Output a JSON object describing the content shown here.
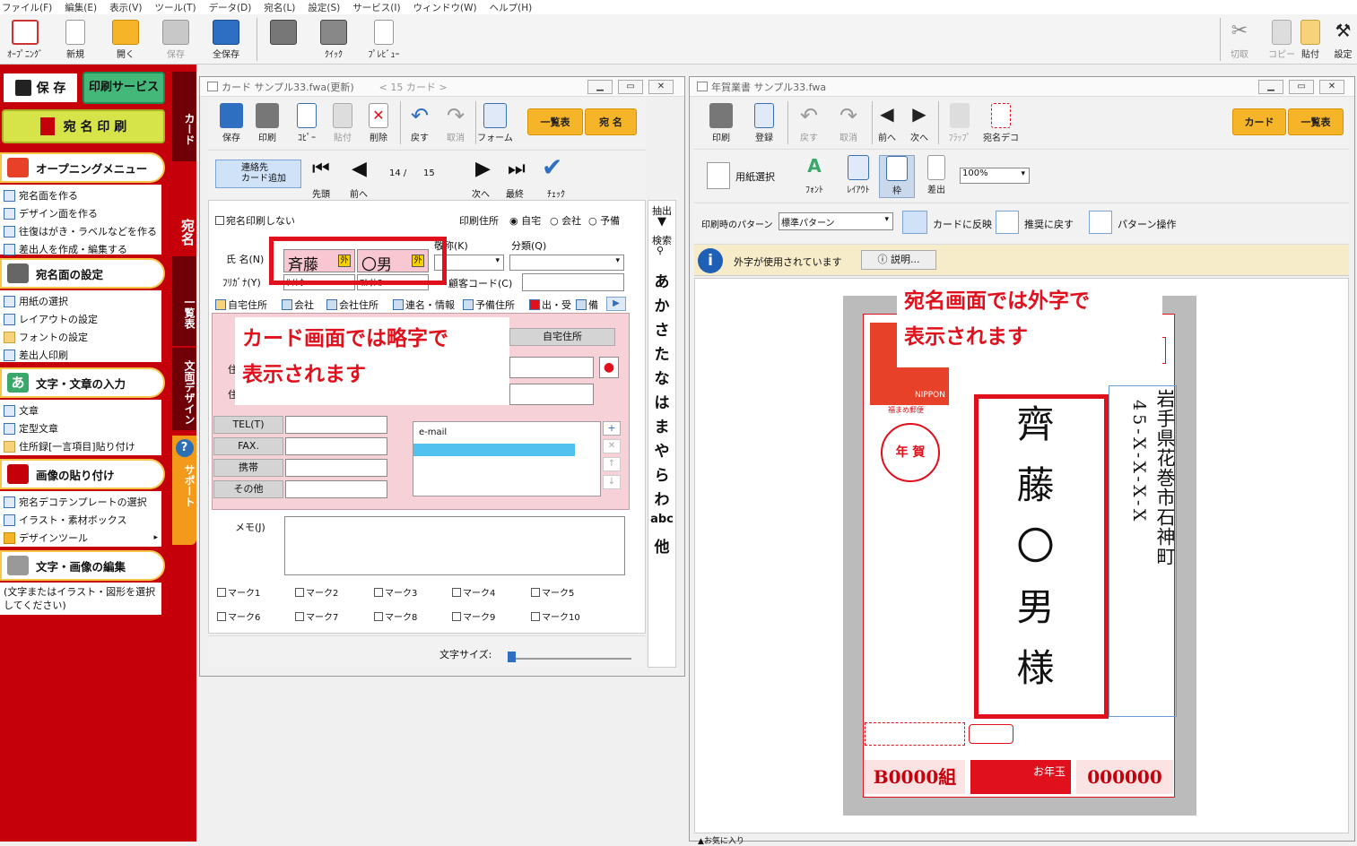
{
  "menu": [
    "ファイル(F)",
    "編集(E)",
    "表示(V)",
    "ツール(T)",
    "データ(D)",
    "宛名(L)",
    "設定(S)",
    "サービス(I)",
    "ウィンドウ(W)",
    "ヘルプ(H)"
  ],
  "toolbar": {
    "opening": "ｵｰﾌﾟﾆﾝｸﾞ",
    "new": "新規",
    "open": "開く",
    "save": "保存",
    "save_all": "全保存",
    "quick": "ｸｲｯｸ",
    "preview": "ﾌﾟﾚﾋﾞｭｰ",
    "cut": "切取",
    "copy": "コピー",
    "paste": "貼付",
    "settings": "設定"
  },
  "left": {
    "save_btn": "保 存",
    "print_service": "印刷サービス",
    "address_print": "宛 名 印 刷",
    "sections": [
      {
        "title": "オープニングメニュー",
        "items": [
          "宛名面を作る",
          "デザイン面を作る",
          "往復はがき・ラベルなどを作る",
          "差出人を作成・編集する"
        ]
      },
      {
        "title": "宛名面の設定",
        "items": [
          "用紙の選択",
          "レイアウトの設定",
          "フォントの設定",
          "差出人印刷"
        ]
      },
      {
        "title": "文字・文章の入力",
        "items": [
          "文章",
          "定型文章",
          "住所録[一言項目]貼り付け"
        ]
      },
      {
        "title": "画像の貼り付け",
        "items": [
          "宛名デコテンプレートの選択",
          "イラスト・素材ボックス",
          "デザインツール"
        ]
      },
      {
        "title": "文字・画像の編集",
        "items": []
      }
    ],
    "edit_hint": "(文字またはイラスト・図形を選択してください)"
  },
  "vtabs": [
    "カード",
    "宛名",
    "一覧表",
    "文面デザイン",
    "サポート"
  ],
  "card": {
    "title": "カード サンプル33.fwa(更新)",
    "count": "< 15 カード >",
    "tb": [
      "保存",
      "印刷",
      "ｺﾋﾟｰ",
      "貼付",
      "削除",
      "戻す",
      "取消",
      "フォーム"
    ],
    "list_btn": "一覧表",
    "address_btn": "宛 名",
    "add_contact": "連絡先\nカード追加",
    "nav": {
      "first": "先頭",
      "prev": "前へ",
      "current": "14 /",
      "total": "15",
      "next": "次へ",
      "last": "最終",
      "check": "ﾁｪｯｸ"
    },
    "no_print": "宛名印刷しない",
    "print_addr_label": "印刷住所",
    "print_addr_opts": [
      "自宅",
      "会社",
      "予備"
    ],
    "name_label": "氏 名(N)",
    "surname": "斉藤",
    "given": "〇男",
    "gaiji": "外",
    "honorific_label": "敬称(K)",
    "category_label": "分類(Q)",
    "furigana_label": "ﾌﾘｶﾞﾅ(Y)",
    "furigana_sei": "ｻｲﾄｳ",
    "furigana_mei": "ﾏﾙｵﾄｺ",
    "customer_code": "顧客コード(C)",
    "tabs": [
      "自宅住所",
      "会社",
      "会社住所",
      "連名・情報",
      "予備住所",
      "出・受",
      "備"
    ],
    "home_addr_hdr": "自宅住所",
    "addr_label": "住",
    "tel": "TEL(T)",
    "fax": "FAX.",
    "mobile": "携帯",
    "other": "その他",
    "email_label": "e-mail",
    "memo_label": "メモ(J)",
    "marks": [
      "マーク1",
      "マーク2",
      "マーク3",
      "マーク4",
      "マーク5",
      "マーク6",
      "マーク7",
      "マーク8",
      "マーク9",
      "マーク10"
    ],
    "font_size_label": "文字サイズ:",
    "extract": "抽出",
    "search": "検索",
    "kana": [
      "あ",
      "か",
      "さ",
      "た",
      "な",
      "は",
      "ま",
      "や",
      "ら",
      "わ",
      "abc",
      "他"
    ],
    "note": "カード画面では略字で\n表示されます"
  },
  "nenga": {
    "title": "年賀業書 サンプル33.fwa",
    "tb": [
      "印刷",
      "登録",
      "戻す",
      "取消",
      "前へ",
      "次へ",
      "ﾌﾗｯﾌﾟ",
      "宛名デコ"
    ],
    "card_btn": "カード",
    "list_btn": "一覧表",
    "tb2": [
      "用紙選択",
      "ﾌｫﾝﾄ",
      "ﾚｲｱｳﾄ",
      "枠",
      "差出"
    ],
    "zoom": "100%",
    "pattern_label": "印刷時のパターン",
    "pattern_value": "標準パターン",
    "reflect": "カードに反映",
    "restore": "推奨に戻す",
    "pattern_op": "パターン操作",
    "gaiji_info": "外字が使用されています",
    "explain": "説明...",
    "note": "宛名画面では外字で\n表示されます",
    "recipient_name": "齊藤〇男様",
    "address": "岩手県花巻市石神町",
    "address_num": "45-X-X-X-X",
    "nippon": "NIPPON",
    "stamp_sub": "福まめ郵便",
    "nenga_stamp": "年 賀",
    "lottery_group": "B0000組",
    "otoshidama": "お年玉",
    "lottery_num": "000000",
    "favorites": "お気に入り"
  }
}
